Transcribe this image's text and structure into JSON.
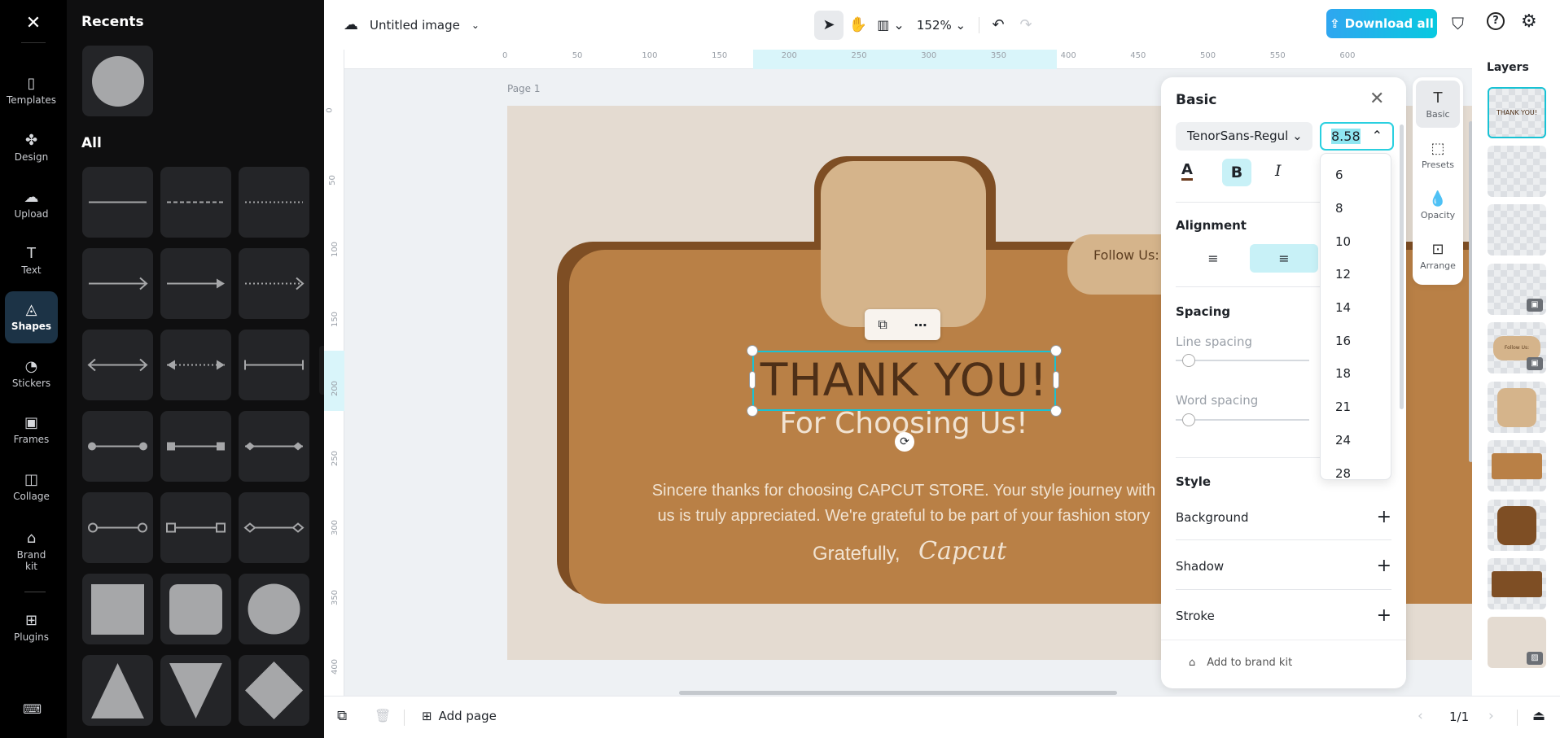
{
  "app": {
    "logo": "capcut-logo",
    "title": "Untitled image",
    "zoom": "152%",
    "download_label": "Download all",
    "accent": "#22b8e8"
  },
  "rail": [
    {
      "label": "Templates",
      "icon": "templates-icon"
    },
    {
      "label": "Design",
      "icon": "design-icon"
    },
    {
      "label": "Upload",
      "icon": "upload-icon"
    },
    {
      "label": "Text",
      "icon": "text-icon"
    },
    {
      "label": "Shapes",
      "icon": "shapes-icon",
      "active": true
    },
    {
      "label": "Stickers",
      "icon": "stickers-icon"
    },
    {
      "label": "Frames",
      "icon": "frames-icon"
    },
    {
      "label": "Collage",
      "icon": "collage-icon"
    },
    {
      "label": "Brand kit",
      "icon": "brand-kit-icon"
    },
    {
      "label": "Plugins",
      "icon": "plugins-icon"
    }
  ],
  "shapes_panel": {
    "recents_title": "Recents",
    "all_title": "All",
    "items": [
      "line",
      "dashed-line",
      "dotted-line",
      "arrow",
      "arrow-filled",
      "dotted-arrow",
      "double-arrow",
      "dotted-double-arrow",
      "bar-line",
      "dot-line",
      "square-end-line",
      "diamond-end-line",
      "circle-outline-line",
      "square-outline-line",
      "diamond-outline-line",
      "square",
      "rounded-square",
      "circle",
      "triangle",
      "inverted-triangle",
      "diamond"
    ]
  },
  "ruler": {
    "h": [
      "0",
      "50",
      "100",
      "150",
      "200",
      "250",
      "300",
      "350",
      "400",
      "450",
      "500",
      "550",
      "600"
    ],
    "v": [
      "0",
      "50",
      "100",
      "150",
      "200",
      "250",
      "300",
      "350",
      "400"
    ]
  },
  "canvas": {
    "page_label": "Page 1",
    "title": "THANK YOU!",
    "subtitle": "For Choosing Us!",
    "follow": "Follow Us:",
    "body_line1": "Sincere thanks for choosing CAPCUT STORE. Your style journey with",
    "body_line2": "us is truly appreciated. We're grateful to be part of your fashion story",
    "signoff": "Gratefully,",
    "signature": "Capcut",
    "colors": {
      "bg": "#e4dbd1",
      "dark": "#7e4e24",
      "main": "#b98046",
      "light": "#d5b48b",
      "title": "#4e2f17",
      "text": "#f1e3d2"
    }
  },
  "props": {
    "title": "Basic",
    "font": "TenorSans-Regul",
    "font_size": "8.58",
    "alignment": "Alignment",
    "spacing": "Spacing",
    "line_spacing": "Line spacing",
    "word_spacing": "Word spacing",
    "line_spacing_value": 0,
    "word_spacing_value": 0,
    "style": "Style",
    "background": "Background",
    "shadow": "Shadow",
    "stroke": "Stroke",
    "brand_kit": "Add to brand kit",
    "size_options": [
      "6",
      "8",
      "10",
      "12",
      "14",
      "16",
      "18",
      "21",
      "24",
      "28"
    ]
  },
  "side_tabs": [
    {
      "label": "Basic",
      "icon": "text-icon"
    },
    {
      "label": "Presets",
      "icon": "presets-icon"
    },
    {
      "label": "Opacity",
      "icon": "opacity-icon"
    },
    {
      "label": "Arrange",
      "icon": "arrange-icon"
    }
  ],
  "layers": {
    "title": "Layers",
    "thumb1": "THANK YOU!",
    "thumb5": "Follow Us:"
  },
  "bottom": {
    "add_page": "Add page",
    "page_count": "1/1"
  }
}
